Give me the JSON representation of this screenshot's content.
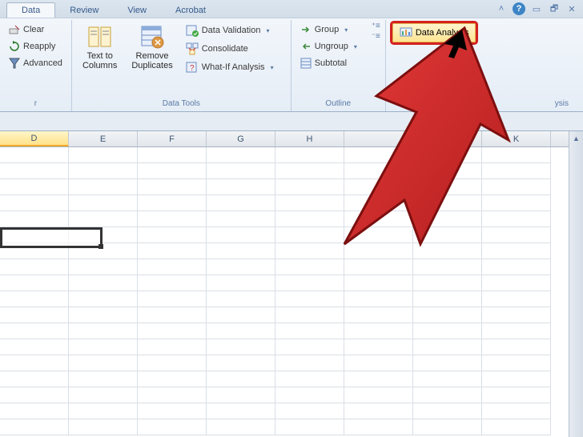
{
  "tabs": {
    "data": "Data",
    "review": "Review",
    "view": "View",
    "acrobat": "Acrobat"
  },
  "sortFilter": {
    "clear": "Clear",
    "reapply": "Reapply",
    "advanced": "Advanced",
    "group_label_suffix": "r"
  },
  "dataTools": {
    "textToColumns": "Text to\nColumns",
    "removeDuplicates": "Remove\nDuplicates",
    "dataValidation": "Data Validation",
    "consolidate": "Consolidate",
    "whatIf": "What-If Analysis",
    "group_label": "Data Tools"
  },
  "outline": {
    "group": "Group",
    "ungroup": "Ungroup",
    "subtotal": "Subtotal",
    "group_label": "Outline"
  },
  "analysis": {
    "dataAnalysis": "Data Analysis",
    "group_label_suffix": "ysis"
  },
  "columns": [
    "D",
    "E",
    "F",
    "G",
    "H",
    "",
    "",
    "K"
  ]
}
